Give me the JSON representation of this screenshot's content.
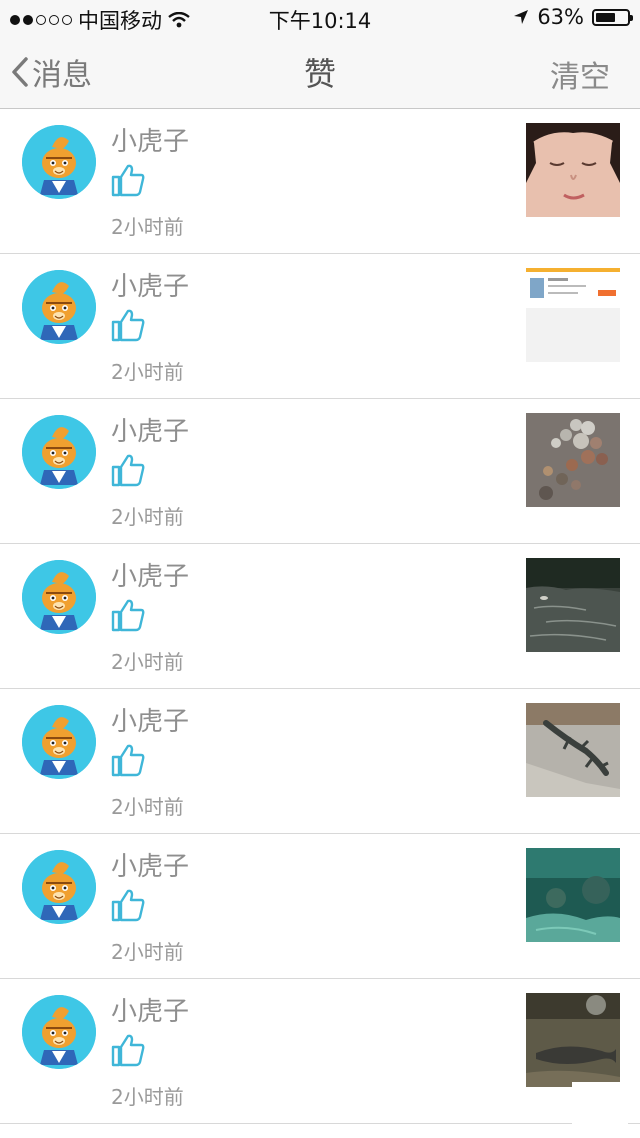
{
  "status": {
    "carrier": "中国移动",
    "time": "下午10:14",
    "battery": "63%",
    "battery_level": 0.63,
    "signal_bars_filled": 2,
    "signal_bars_total": 5
  },
  "nav": {
    "back_label": "消息",
    "title": "赞",
    "clear_label": "清空"
  },
  "items": [
    {
      "name": "小虎子",
      "time": "2小时前",
      "thumb": "face-photo"
    },
    {
      "name": "小虎子",
      "time": "2小时前",
      "thumb": "screenshot-photo"
    },
    {
      "name": "小虎子",
      "time": "2小时前",
      "thumb": "coins-photo"
    },
    {
      "name": "小虎子",
      "time": "2小时前",
      "thumb": "pond-photo"
    },
    {
      "name": "小虎子",
      "time": "2小时前",
      "thumb": "lizard-photo"
    },
    {
      "name": "小虎子",
      "time": "2小时前",
      "thumb": "aquarium-photo"
    },
    {
      "name": "小虎子",
      "time": "2小时前",
      "thumb": "fish-photo"
    }
  ],
  "colors": {
    "avatar_bg": "#3ec7e6",
    "like_icon": "#3fb6d8"
  }
}
